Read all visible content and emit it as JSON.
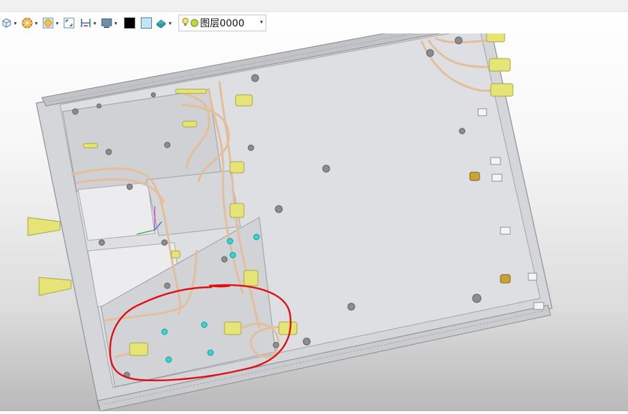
{
  "toolbar": {
    "layer_name": "图层0000",
    "tools": [
      {
        "icon": "view-cube-icon"
      },
      {
        "icon": "render-style-icon"
      },
      {
        "icon": "shading-icon"
      },
      {
        "icon": "zoom-fit-icon"
      },
      {
        "icon": "section-view-icon"
      },
      {
        "icon": "display-mode-icon"
      }
    ],
    "colors": {
      "black": "#000000",
      "light_blue": "#bfe6f5",
      "teal_fill": "#4cb8c8"
    },
    "layer_indicator_colors": {
      "bulb": "#f2e36b",
      "dot": "#b9d84a"
    }
  },
  "viewport": {
    "annotation": {
      "shape": "freehand-circle",
      "color": "#e01010"
    },
    "model_colors": {
      "chassis": "#d4d5d8",
      "cable": "#e3be9a",
      "connector": "#e6e377",
      "screw_cyan": "#33d6d6"
    }
  }
}
